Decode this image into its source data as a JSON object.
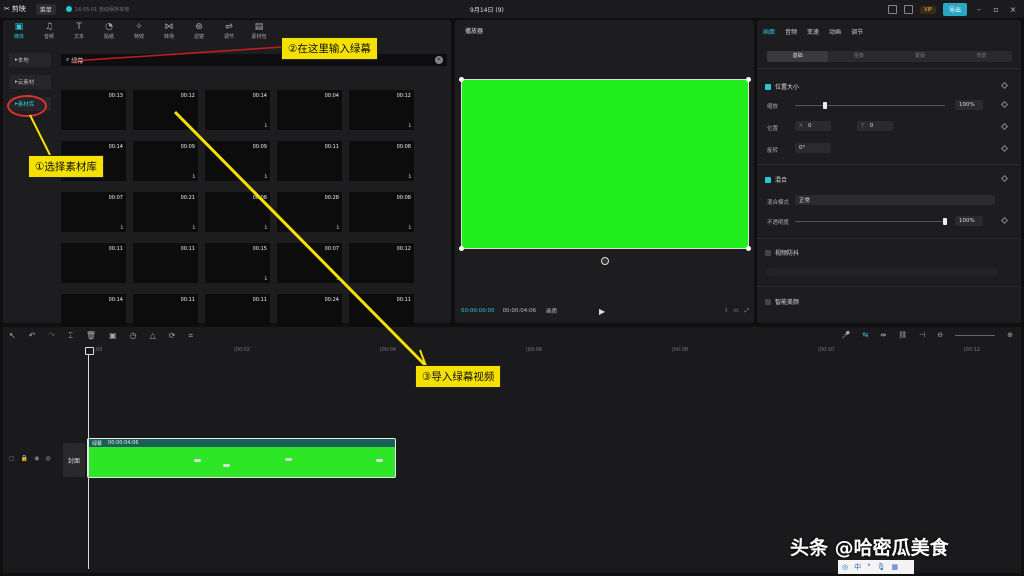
{
  "app": {
    "logo": "剪映",
    "menu": "菜单",
    "autosave": "16:05:01 自动保存本地",
    "project_title": "9月14日 (9)",
    "vip": "VIP",
    "export": "导出"
  },
  "media": {
    "tools": [
      {
        "label": "媒体",
        "icon": "media-icon"
      },
      {
        "label": "音频",
        "icon": "audio-icon"
      },
      {
        "label": "文本",
        "icon": "text-icon"
      },
      {
        "label": "贴纸",
        "icon": "sticker-icon"
      },
      {
        "label": "特效",
        "icon": "effects-icon"
      },
      {
        "label": "转场",
        "icon": "transition-icon"
      },
      {
        "label": "滤镜",
        "icon": "filter-icon"
      },
      {
        "label": "调节",
        "icon": "adjust-icon"
      },
      {
        "label": "素材包",
        "icon": "package-icon"
      }
    ],
    "side": [
      "本地",
      "云素材",
      "素材库"
    ],
    "search_value": "绿幕",
    "thumbs": [
      {
        "dur": "00:13",
        "dl": false
      },
      {
        "dur": "00:12",
        "dl": false
      },
      {
        "dur": "00:14",
        "dl": true
      },
      {
        "dur": "00:04",
        "dl": false
      },
      {
        "dur": "00:12",
        "dl": true
      },
      {
        "dur": "00:14",
        "dl": false
      },
      {
        "dur": "00:09",
        "dl": true
      },
      {
        "dur": "00:09",
        "dl": true
      },
      {
        "dur": "00:11",
        "dl": false
      },
      {
        "dur": "00:08",
        "dl": true
      },
      {
        "dur": "00:07",
        "dl": true
      },
      {
        "dur": "00:21",
        "dl": true
      },
      {
        "dur": "00:08",
        "dl": true
      },
      {
        "dur": "00:28",
        "dl": true
      },
      {
        "dur": "00:08",
        "dl": true
      },
      {
        "dur": "00:11",
        "dl": false
      },
      {
        "dur": "00:11",
        "dl": false
      },
      {
        "dur": "00:15",
        "dl": true
      },
      {
        "dur": "00:07",
        "dl": true
      },
      {
        "dur": "00:12",
        "dl": false
      },
      {
        "dur": "00:14",
        "dl": false
      },
      {
        "dur": "00:11",
        "dl": false
      },
      {
        "dur": "00:11",
        "dl": false
      },
      {
        "dur": "00:24",
        "dl": false
      },
      {
        "dur": "00:11",
        "dl": false
      }
    ]
  },
  "player": {
    "title": "播放器",
    "current": "00:00:00:00",
    "total": "00:00:04:06",
    "ratio": "画质"
  },
  "props": {
    "tabs": [
      "画面",
      "音频",
      "变速",
      "动画",
      "调节"
    ],
    "subtabs": [
      "基础",
      "抠像",
      "蒙版",
      "背景"
    ],
    "pos_size": "位置大小",
    "scale_label": "缩放",
    "scale_value": "100%",
    "position_label": "位置",
    "x": "0",
    "y": "0",
    "rotate_label": "旋转",
    "rotate_value": "0°",
    "blend": "混合",
    "blend_mode_label": "混合模式",
    "blend_mode": "正常",
    "opacity_label": "不透明度",
    "opacity_value": "100%",
    "stabilize": "视频防抖",
    "beauty": "智能美颜"
  },
  "timeline": {
    "ticks": [
      "00:00",
      "|00:02",
      "|00:04",
      "|00:06",
      "|00:08",
      "|00:10",
      "|00:12"
    ],
    "cover": "封面",
    "clip_name": "绿幕",
    "clip_duration": "00:00:04:06"
  },
  "annotations": {
    "step1": "①选择素材库",
    "step2": "②在这里输入绿幕",
    "step3": "③导入绿幕视频"
  },
  "watermark": "头条 @哈密瓜美食",
  "ime": "中"
}
